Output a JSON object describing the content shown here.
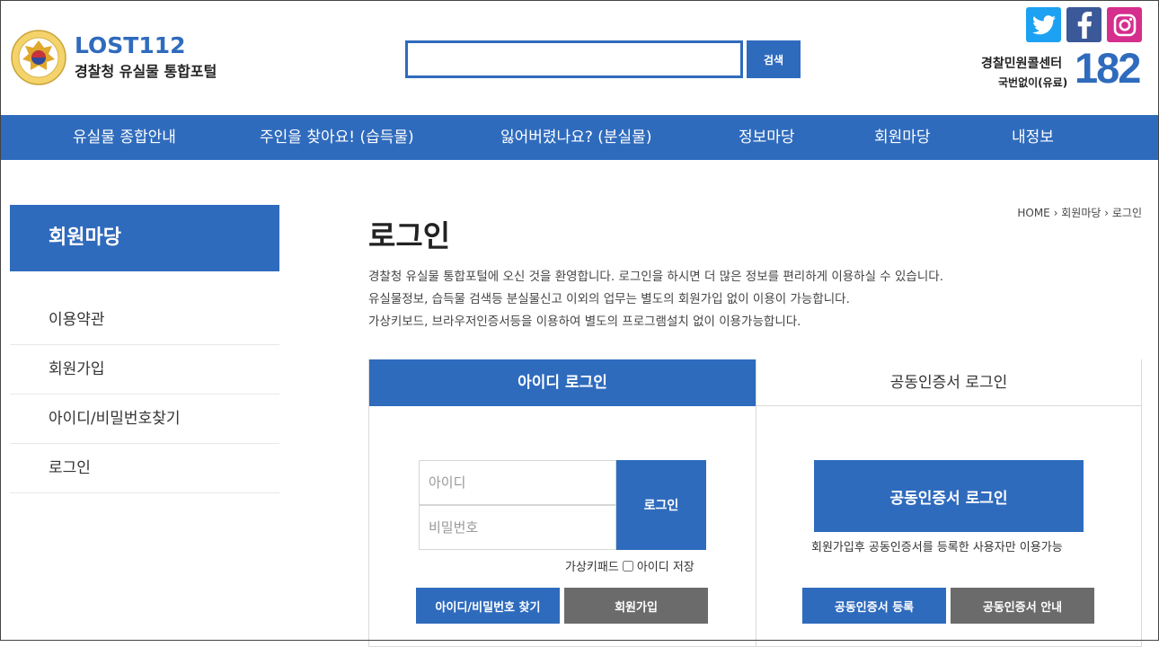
{
  "header": {
    "brand_title": "LOST112",
    "brand_subtitle": "경찰청 유실물 통합포털",
    "search_placeholder": "",
    "search_button": "검색",
    "call_center_label": "경찰민원콜센터",
    "call_center_sub": "국번없이(유료)",
    "call_center_number": "182",
    "social": [
      "twitter-icon",
      "facebook-icon",
      "instagram-icon"
    ],
    "brand_color": "#2f6bbd"
  },
  "nav": {
    "items": [
      "유실물 종합안내",
      "주인을 찾아요! (습득물)",
      "잃어버렸나요? (분실물)",
      "정보마당",
      "회원마당",
      "내정보"
    ]
  },
  "sidebar": {
    "heading": "회원마당",
    "items": [
      "이용약관",
      "회원가입",
      "아이디/비밀번호찾기",
      "로그인"
    ]
  },
  "main": {
    "breadcrumb": [
      "HOME",
      "회원마당",
      "로그인"
    ],
    "title": "로그인",
    "intro": [
      "경찰청 유실물 통합포털에 오신 것을 환영합니다. 로그인을 하시면 더 많은 정보를 편리하게 이용하실 수 있습니다.",
      "유실물정보, 습득물 검색등 분실물신고 이외의 업무는 별도의 회원가입 없이 이용이 가능합니다.",
      "가상키보드, 브라우저인증서등을 이용하여 별도의 프로그램설치 없이 이용가능합니다."
    ]
  },
  "login": {
    "tab_id": "아이디 로그인",
    "tab_cert": "공동인증서 로그인",
    "id_placeholder": "아이디",
    "pw_placeholder": "비밀번호",
    "login_button": "로그인",
    "virtual_keypad": "가상키패드",
    "save_id": "아이디 저장",
    "find_button": "아이디/비밀번호 찾기",
    "join_button": "회원가입",
    "cert_login_button": "공동인증서 로그인",
    "cert_note": "회원가입후 공동인증서를 등록한 사용자만 이용가능",
    "cert_register_button": "공동인증서 등록",
    "cert_guide_button": "공동인증서 안내"
  }
}
